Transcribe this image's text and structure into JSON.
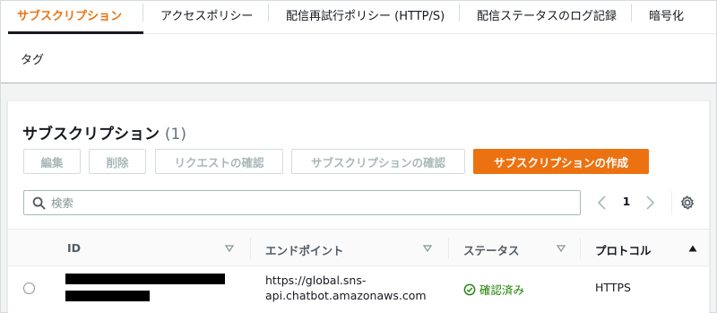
{
  "tabs": [
    {
      "label": "サブスクリプション",
      "active": true
    },
    {
      "label": "アクセスポリシー",
      "active": false
    },
    {
      "label": "配信再試行ポリシー (HTTP/S)",
      "active": false
    },
    {
      "label": "配信ステータスのログ記録",
      "active": false
    },
    {
      "label": "暗号化",
      "active": false
    },
    {
      "label": "タグ",
      "active": false
    }
  ],
  "panel": {
    "title": "サブスクリプション",
    "count": "(1)"
  },
  "buttons": {
    "edit": "編集",
    "delete": "削除",
    "request_confirmation": "リクエストの確認",
    "confirm_subscription": "サブスクリプションの確認",
    "create_subscription": "サブスクリプションの作成"
  },
  "search": {
    "placeholder": "検索",
    "value": ""
  },
  "pagination": {
    "current_page": "1"
  },
  "table": {
    "columns": [
      "ID",
      "エンドポイント",
      "ステータス",
      "プロトコル"
    ],
    "sorted_column": "プロトコル",
    "sort_direction": "ascending",
    "rows": [
      {
        "id": "",
        "endpoint": "https://global.sns-api.chatbot.amazonaws.com",
        "endpoint_line1": "https://global.sns-",
        "endpoint_line2": "api.chatbot.amazonaws.com",
        "status": "確認済み",
        "protocol": "HTTPS",
        "selected": false
      }
    ]
  },
  "colors": {
    "accent": "#ec7211",
    "text": "#16191f",
    "muted": "#687078",
    "success": "#1d8102",
    "disabled": "#aab7b8",
    "border": "#eaeded"
  },
  "icons": [
    "search-icon",
    "chevron-left-icon",
    "chevron-right-icon",
    "gear-icon",
    "sort-caret-icon",
    "sort-ascending-icon",
    "check-circle-icon"
  ]
}
